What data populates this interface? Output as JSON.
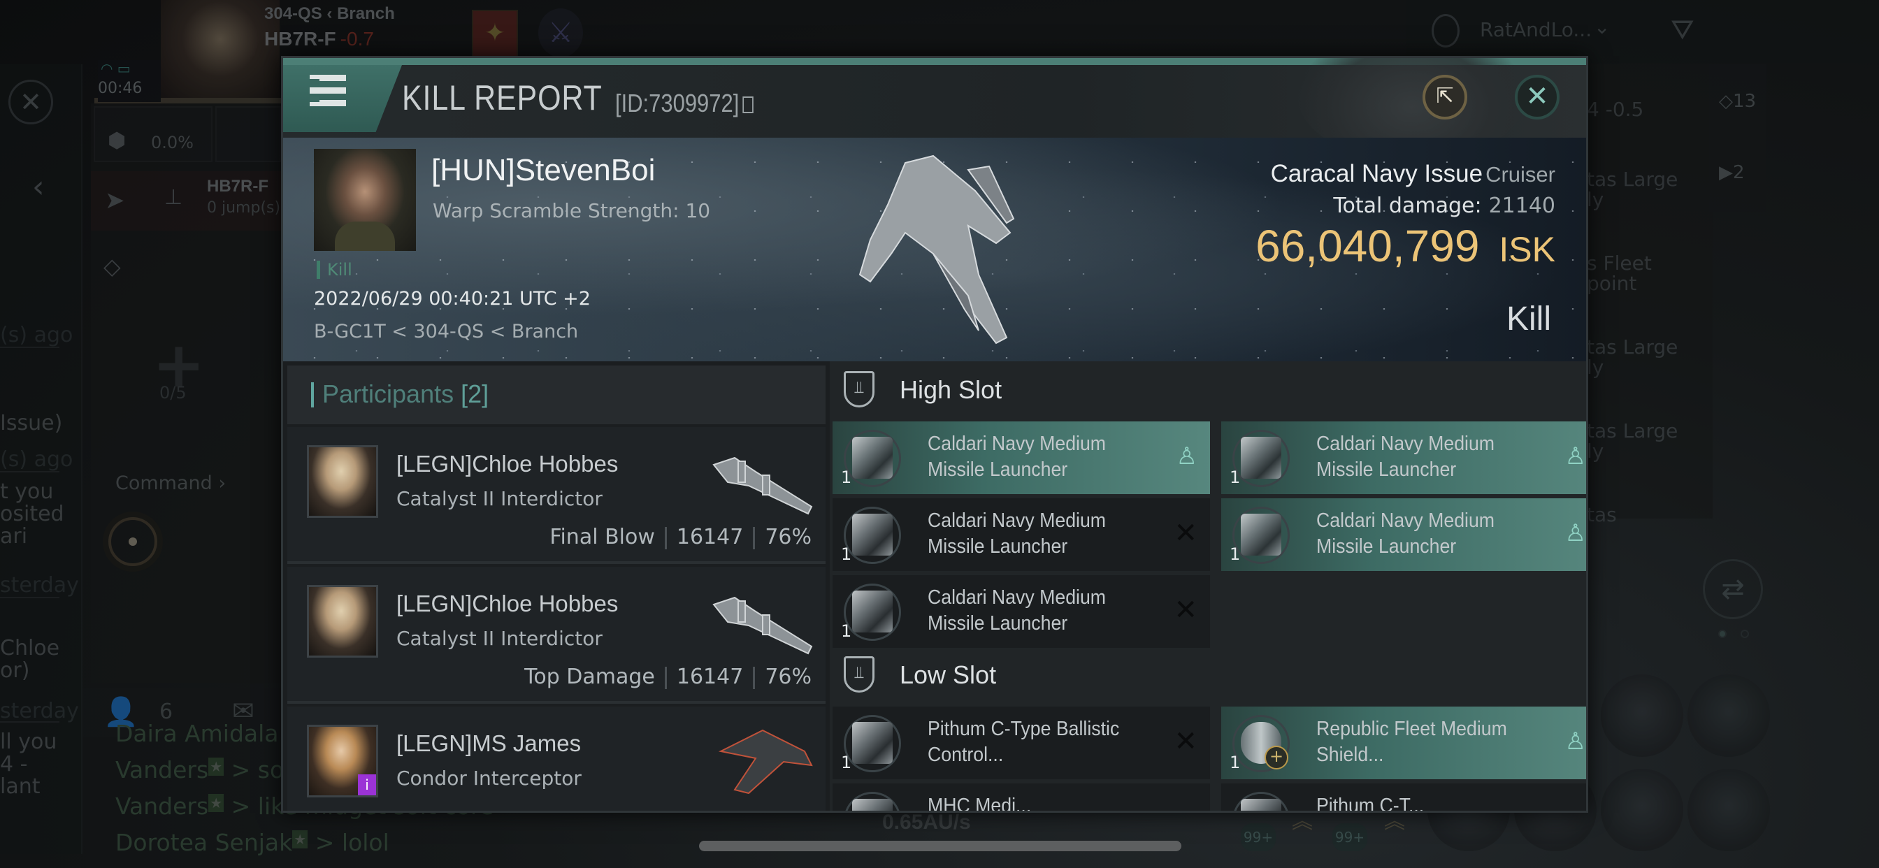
{
  "background": {
    "system_path": {
      "constellation": "304-QS",
      "region": "Branch"
    },
    "current_system": {
      "name": "HB7R-F",
      "security": "-0.7"
    },
    "clock": "00:46",
    "cargo_percent": "0.0%",
    "route": {
      "destination": "HB7R-F",
      "jumps": "0 jump(s)"
    },
    "fleet": {
      "count": "0/5",
      "command_label": "Command"
    },
    "chat_snippets_left": [
      "(s) ago",
      "Issue)",
      "(s) ago",
      "t you",
      "osited",
      "ari",
      "sterday",
      "Chloe",
      "or)",
      "sterday",
      "ll you",
      "4 -",
      "lant"
    ],
    "local_count": "6",
    "chat_messages": [
      {
        "sender": "Daira Amidala",
        "text": ""
      },
      {
        "sender": "Vanders",
        "text": "> so"
      },
      {
        "sender": "Vanders",
        "text": "> like midget soft core"
      },
      {
        "sender": "Dorotea Senjak",
        "text": "> lolol"
      }
    ],
    "overview": {
      "profile": "RatAndLo...",
      "rows": [
        "4 -0.5",
        "tas Large\nly",
        "s Fleet\npoint",
        "tas Large\nly",
        "tas Large\nly",
        "tas"
      ],
      "counters": [
        "13",
        "2"
      ]
    },
    "speed": "0.65AU/s",
    "ammo_badges": [
      "99+",
      "99+"
    ]
  },
  "modal": {
    "title": "KILL REPORT",
    "id_label": "[ID:7309972]",
    "victim": {
      "name": "[HUN]StevenBoi",
      "subtitle": "Warp Scramble Strength: 10",
      "tag": "Kill",
      "timestamp": "2022/06/29 00:40:21 UTC +2",
      "location": "B-GC1T < 304-QS < Branch",
      "ship_name": "Caracal Navy Issue",
      "ship_class": "Cruiser",
      "total_damage_label": "Total damage:",
      "total_damage": "21140",
      "isk_value": "66,040,799",
      "isk_unit": "ISK",
      "result": "Kill"
    },
    "participants": {
      "label": "Participants",
      "count": "[2]",
      "rows": [
        {
          "name": "[LEGN]Chloe Hobbes",
          "ship": "Catalyst II Interdictor",
          "role": "Final Blow",
          "damage": "16147",
          "percent": "76%"
        },
        {
          "name": "[LEGN]Chloe Hobbes",
          "ship": "Catalyst II Interdictor",
          "role": "Top Damage",
          "damage": "16147",
          "percent": "76%"
        },
        {
          "name": "[LEGN]MS James",
          "ship": "Condor Interceptor",
          "role": "",
          "damage": "",
          "percent": ""
        }
      ]
    },
    "high_slot": {
      "label": "High Slot",
      "modules": [
        {
          "qty": "1",
          "name": "Caldari Navy Medium Missile Launcher",
          "status": "dropped"
        },
        {
          "qty": "1",
          "name": "Caldari Navy Medium Missile Launcher",
          "status": "dropped"
        },
        {
          "qty": "1",
          "name": "Caldari Navy Medium Missile Launcher",
          "status": "destroyed"
        },
        {
          "qty": "1",
          "name": "Caldari Navy Medium Missile Launcher",
          "status": "dropped"
        },
        {
          "qty": "1",
          "name": "Caldari Navy Medium Missile Launcher",
          "status": "destroyed"
        }
      ]
    },
    "low_slot": {
      "label": "Low Slot",
      "modules": [
        {
          "qty": "1",
          "name": "Pithum C-Type Ballistic Control...",
          "status": "destroyed"
        },
        {
          "qty": "1",
          "name": "Republic Fleet Medium Shield...",
          "status": "dropped"
        },
        {
          "qty": "",
          "name": "MHC Medi...",
          "status": "partial"
        },
        {
          "qty": "",
          "name": "Pithum C-T...",
          "status": "partial"
        }
      ]
    },
    "status_glyphs": {
      "destroyed": "✕",
      "dropped": "♙"
    },
    "colors": {
      "accent": "#4c7f76",
      "isk": "#ecc477",
      "dropped_bg": "#57877e"
    }
  }
}
